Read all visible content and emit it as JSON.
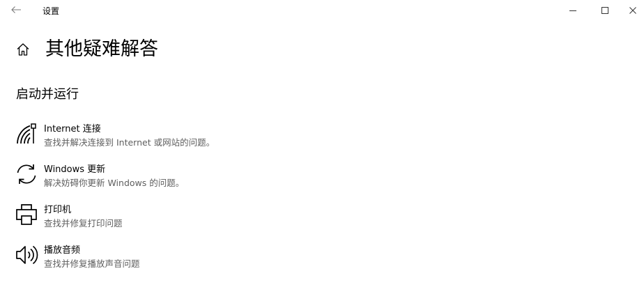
{
  "window": {
    "app_title": "设置"
  },
  "header": {
    "title": "其他疑难解答"
  },
  "section": {
    "title": "启动并运行"
  },
  "troubleshooters": [
    {
      "name": "Internet 连接",
      "desc": "查找并解决连接到 Internet 或网站的问题。",
      "icon": "wifi-icon"
    },
    {
      "name": "Windows 更新",
      "desc": "解决妨碍你更新 Windows 的问题。",
      "icon": "sync-icon"
    },
    {
      "name": "打印机",
      "desc": "查找并修复打印问题",
      "icon": "printer-icon"
    },
    {
      "name": "播放音频",
      "desc": "查找并修复播放声音问题",
      "icon": "speaker-icon"
    }
  ]
}
